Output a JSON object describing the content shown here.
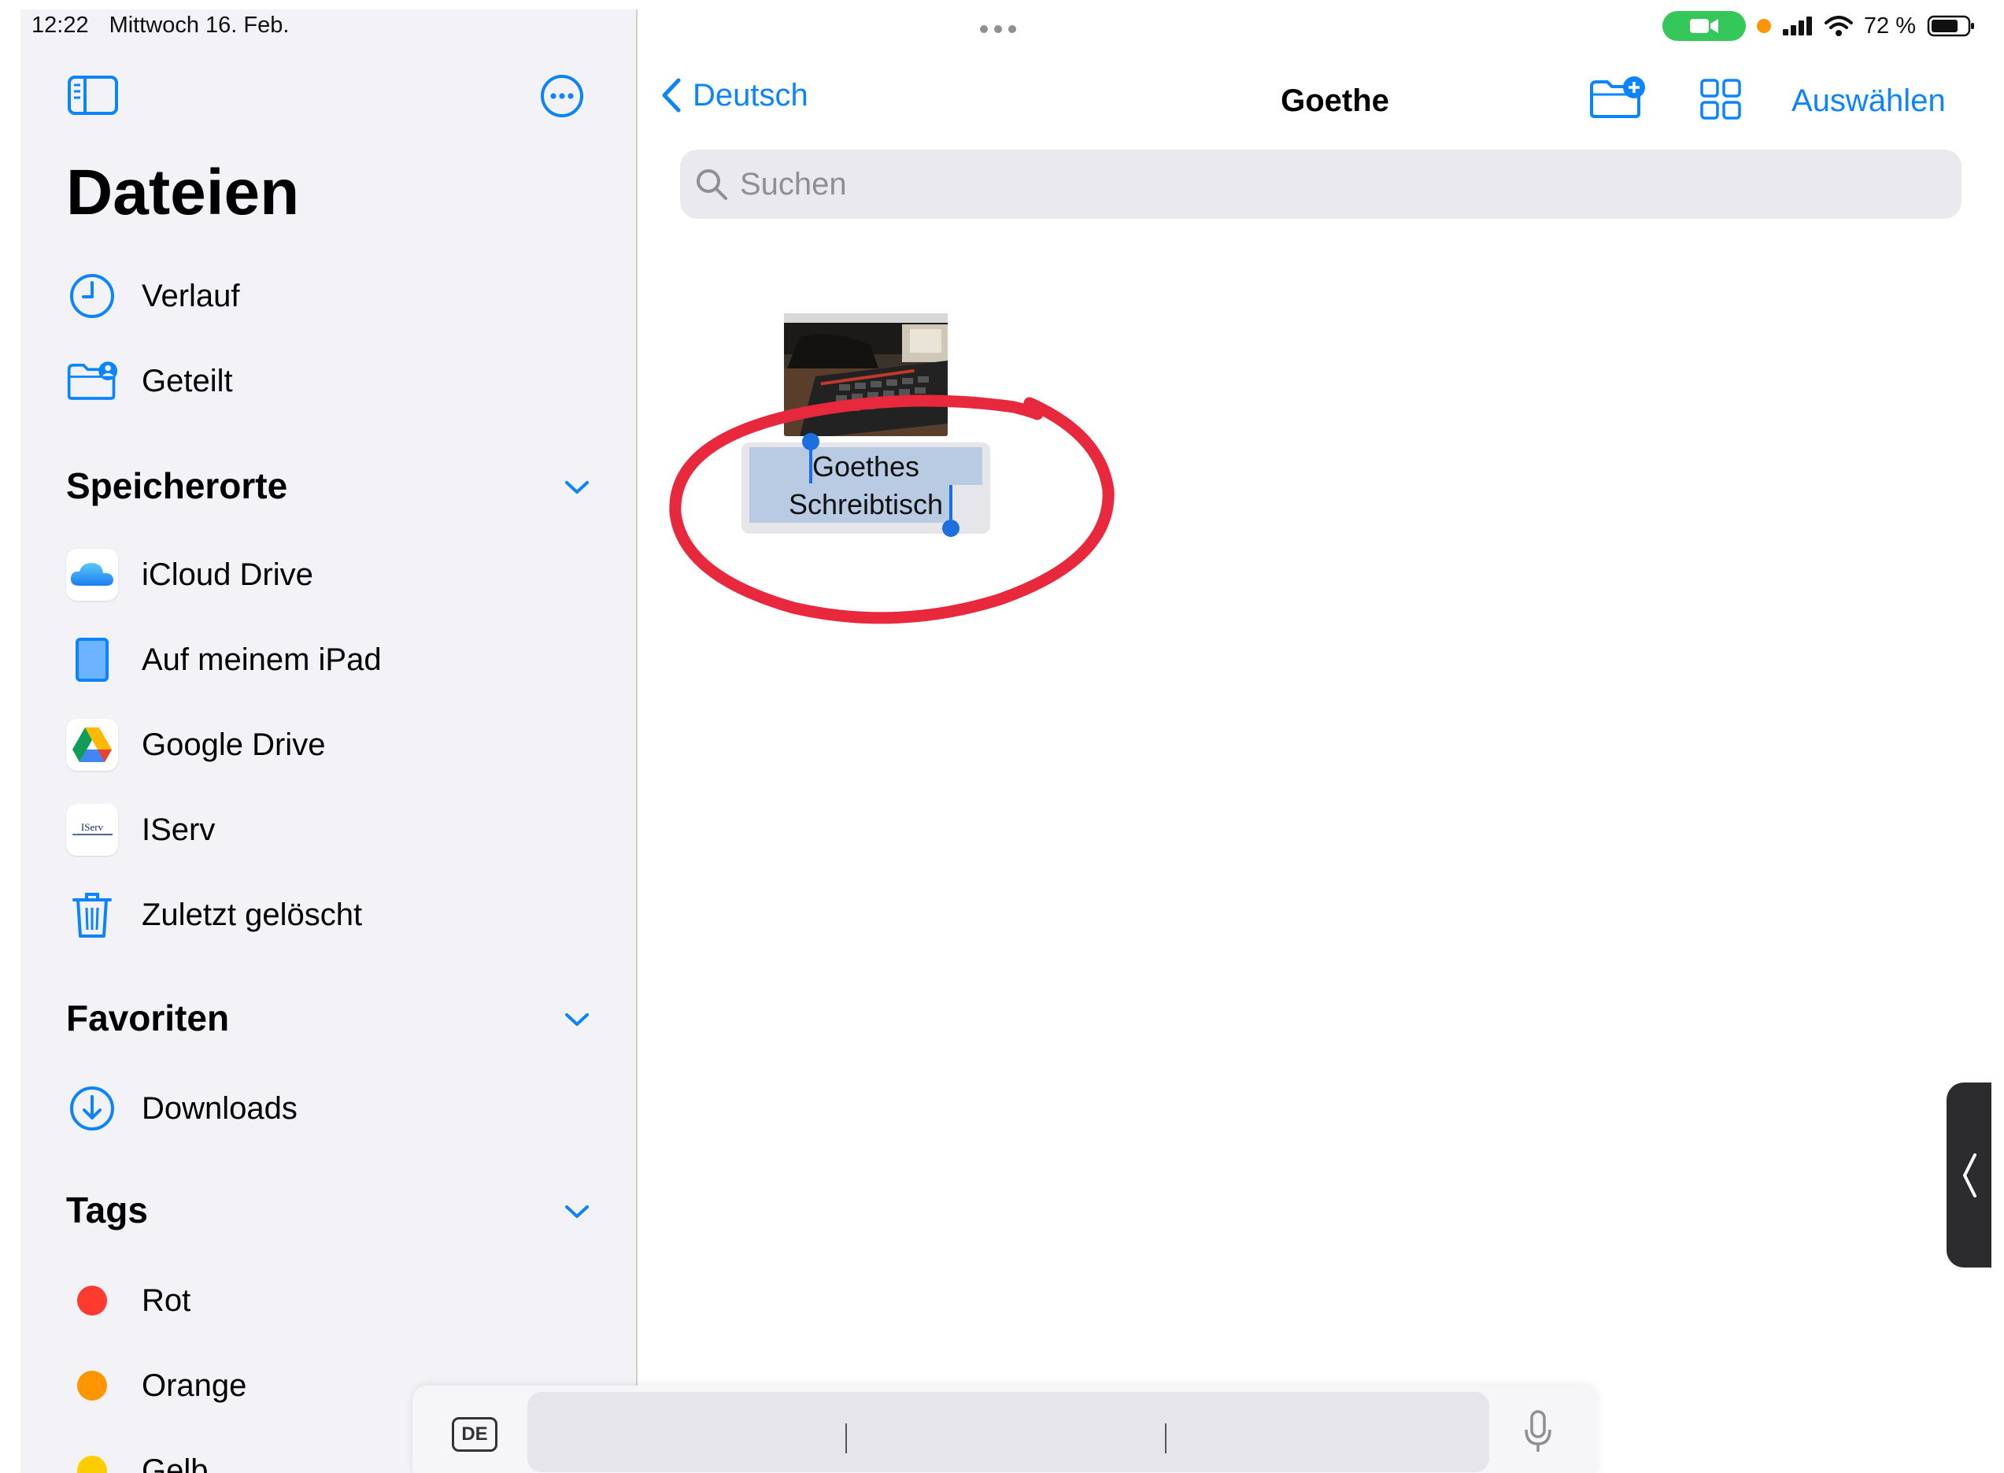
{
  "status": {
    "time": "12:22",
    "date": "Mittwoch 16. Feb.",
    "battery": "72 %"
  },
  "sidebar": {
    "title": "Dateien",
    "top_items": [
      {
        "label": "Verlauf",
        "icon": "clock-icon"
      },
      {
        "label": "Geteilt",
        "icon": "shared-folder-icon"
      }
    ],
    "sections": {
      "locations": {
        "title": "Speicherorte",
        "items": [
          {
            "label": "iCloud Drive",
            "icon": "icloud-icon"
          },
          {
            "label": "Auf meinem iPad",
            "icon": "ipad-icon"
          },
          {
            "label": "Google Drive",
            "icon": "google-drive-icon"
          },
          {
            "label": "IServ",
            "icon": "iserv-logo-icon",
            "logo_text": "IServ"
          },
          {
            "label": "Zuletzt gelöscht",
            "icon": "trash-icon"
          }
        ]
      },
      "favorites": {
        "title": "Favoriten",
        "items": [
          {
            "label": "Downloads",
            "icon": "download-icon"
          }
        ]
      },
      "tags": {
        "title": "Tags",
        "items": [
          {
            "label": "Rot",
            "color": "#ff3b30"
          },
          {
            "label": "Orange",
            "color": "#ff9500"
          },
          {
            "label": "Gelb",
            "color": "#ffcc00"
          }
        ]
      }
    }
  },
  "nav": {
    "back_label": "Deutsch",
    "title": "Goethe",
    "select_label": "Auswählen"
  },
  "search": {
    "placeholder": "Suchen"
  },
  "file": {
    "name_line1": "Goethes",
    "name_line2": "Schreibtisch"
  },
  "keyboard_bar": {
    "language": "DE"
  },
  "colors": {
    "accent": "#0a84ff",
    "annotation": "#e8283c"
  }
}
